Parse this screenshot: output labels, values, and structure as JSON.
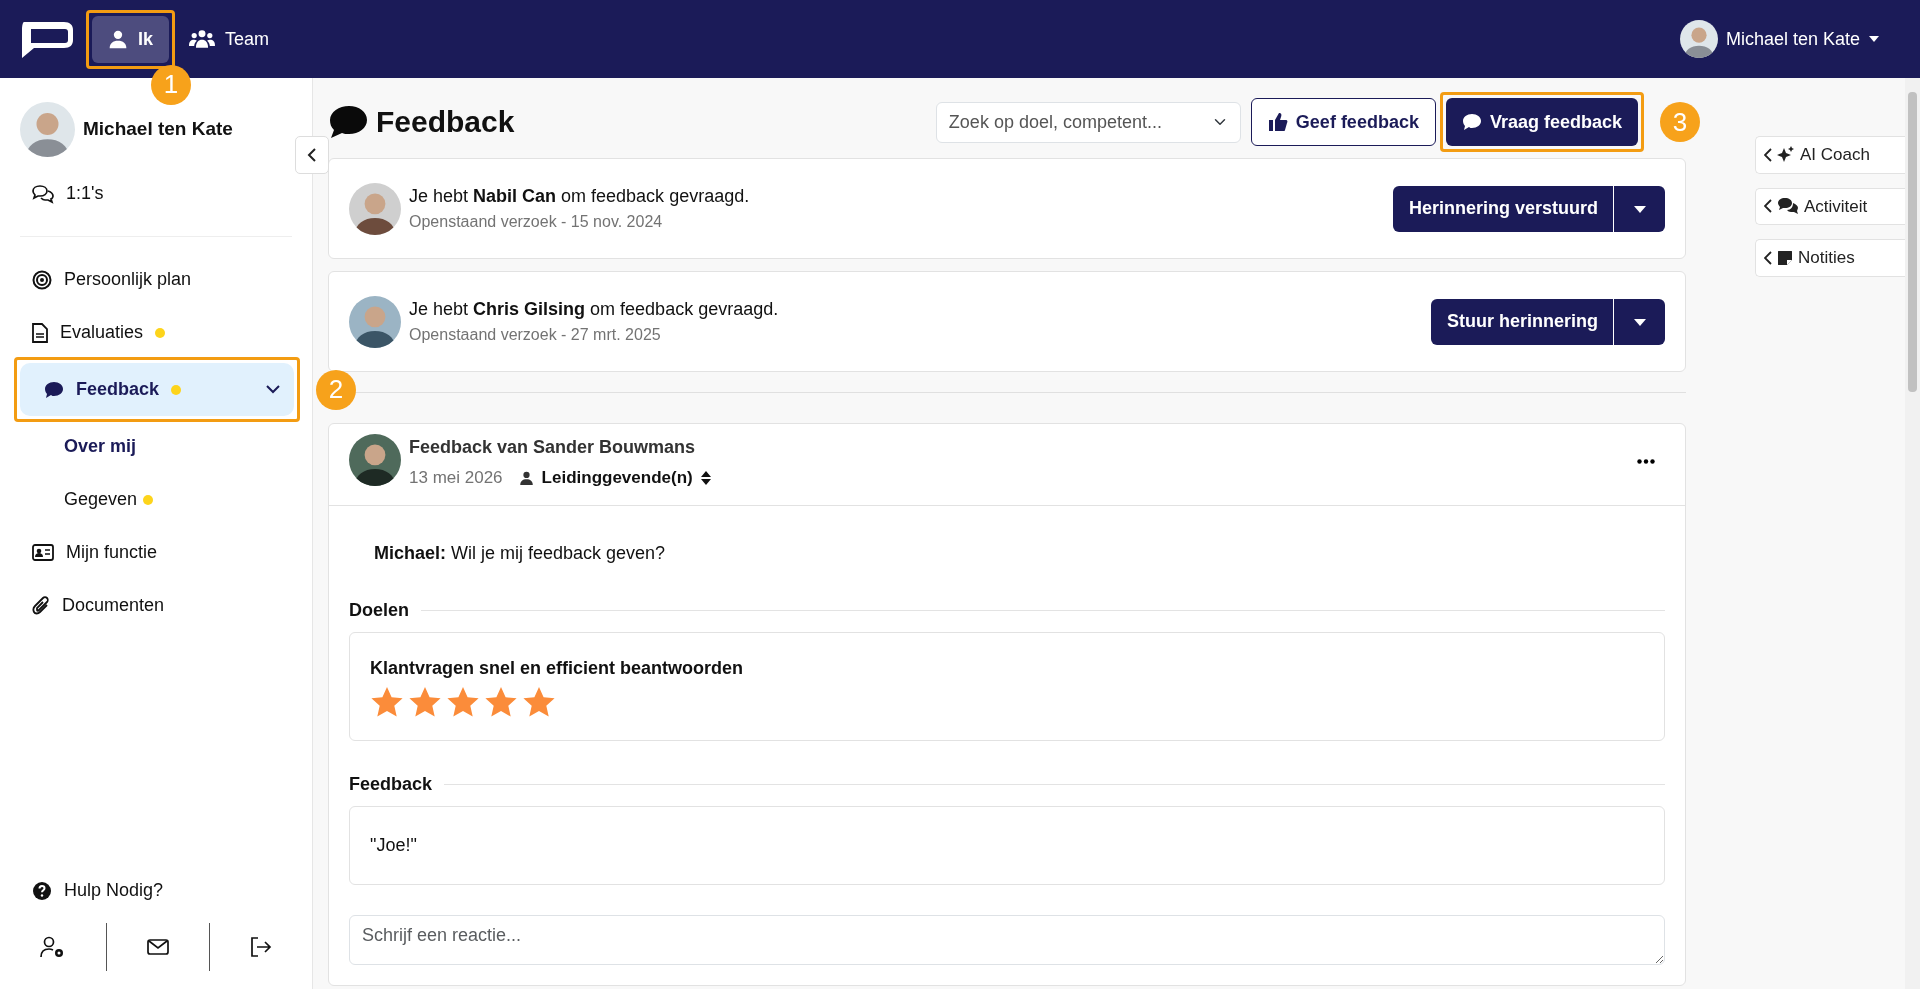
{
  "topbar": {
    "nav": [
      {
        "label": "Ik",
        "selected": true,
        "callout": "1"
      },
      {
        "label": "Team",
        "selected": false
      }
    ],
    "user": "Michael ten Kate"
  },
  "sidebar": {
    "profile_name": "Michael ten Kate",
    "top_items": [
      {
        "label": "1:1's",
        "selected": false,
        "notification": false
      }
    ],
    "items": [
      {
        "label": "Persoonlijk plan",
        "selected": false,
        "notification": false
      },
      {
        "label": "Evaluaties",
        "selected": false,
        "notification": true
      },
      {
        "label": "Feedback",
        "selected": true,
        "notification": true,
        "expanded": true,
        "callout": "2",
        "children": [
          {
            "label": "Over mij",
            "selected": true,
            "notification": false
          },
          {
            "label": "Gegeven",
            "selected": false,
            "notification": true
          }
        ]
      },
      {
        "label": "Mijn functie",
        "selected": false,
        "notification": false
      },
      {
        "label": "Documenten",
        "selected": false,
        "notification": false
      }
    ],
    "help": "Hulp Nodig?"
  },
  "page": {
    "title": "Feedback",
    "filter": {
      "value": "Zoek op doel, competent..."
    },
    "buttons": [
      {
        "label": "Geef feedback",
        "kind": "outline"
      },
      {
        "label": "Vraag feedback",
        "kind": "primary",
        "callout": "3"
      }
    ]
  },
  "requests": [
    {
      "text": "Je hebt **Nabil Can** om feedback gevraagd.",
      "subtitle": "Openstaand verzoek - 15 nov. 2024",
      "action": "Herinnering verstuurd"
    },
    {
      "text": "Je hebt **Chris Gilsing** om feedback gevraagd.",
      "subtitle": "Openstaand verzoek - 27 mrt. 2025",
      "action": "Stuur herinnering"
    }
  ],
  "feedback": {
    "title": "Feedback van **Sander Bouwmans**",
    "date": "13 mei 2026",
    "audience": "Leidinggevende(n)",
    "question": "**Michael:** Wil je mij feedback geven?",
    "sections": [
      {
        "kind": "goals",
        "title": "Doelen",
        "goals": [
          {
            "title": "Klantvragen snel en efficient beantwoorden",
            "stars": 5
          }
        ]
      },
      {
        "kind": "text",
        "title": "Feedback",
        "text": "\"Joe!\""
      }
    ],
    "reply": {
      "placeholder": "Schrijf een reactie..."
    }
  },
  "side_panels": [
    {
      "label": "AI Coach"
    },
    {
      "label": "Activiteit"
    },
    {
      "label": "Notities"
    }
  ]
}
